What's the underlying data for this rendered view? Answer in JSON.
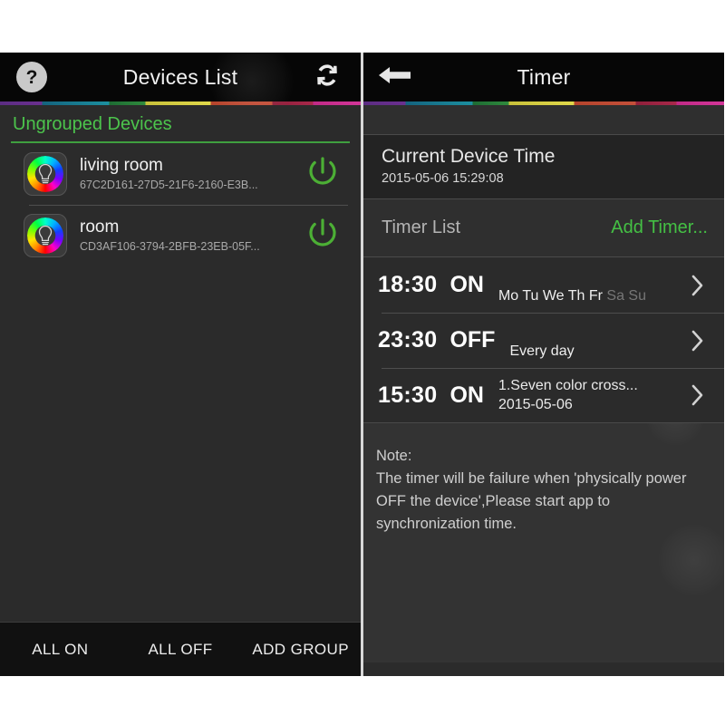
{
  "left_panel": {
    "navbar": {
      "help_label": "?",
      "title": "Devices List",
      "refresh_icon": "refresh-icon"
    },
    "group": {
      "label": "Ungrouped Devices"
    },
    "devices": [
      {
        "name": "living room",
        "uuid": "67C2D161-27D5-21F6-2160-E3B...",
        "icon": "rgb-bulb-icon",
        "power_icon": "power-icon",
        "power_color": "#4caf35"
      },
      {
        "name": "room",
        "uuid": "CD3AF106-3794-2BFB-23EB-05F...",
        "icon": "rgb-bulb-icon",
        "power_icon": "power-icon",
        "power_color": "#4caf35"
      }
    ],
    "bottom_bar": {
      "all_on": "ALL ON",
      "all_off": "ALL OFF",
      "add_group": "ADD GROUP"
    }
  },
  "right_panel": {
    "navbar": {
      "back_icon": "back-arrow-icon",
      "title": "Timer"
    },
    "current_device_time": {
      "title": "Current Device Time",
      "value": "2015-05-06 15:29:08"
    },
    "timer_list": {
      "title": "Timer List",
      "add_label": "Add Timer...",
      "add_color": "#44c044"
    },
    "timers": [
      {
        "time": "18:30",
        "state": "ON",
        "days_active": "Mo Tu We Th Fr",
        "days_inactive": "Sa Su",
        "sub": "",
        "chevron": "chevron-right-icon"
      },
      {
        "time": "23:30",
        "state": "OFF",
        "days_active": "Every day",
        "days_inactive": "",
        "sub": "",
        "chevron": "chevron-right-icon"
      },
      {
        "time": "15:30",
        "state": "ON",
        "days_active": "",
        "days_inactive": "",
        "sub_line1": "1.Seven color cross...",
        "sub_line2": "2015-05-06",
        "chevron": "chevron-right-icon"
      }
    ],
    "note": {
      "line1": "Note:",
      "line2": "The timer will be failure when 'physically power",
      "line3": "OFF the device',Please start app to",
      "line4": "synchronization time."
    }
  }
}
